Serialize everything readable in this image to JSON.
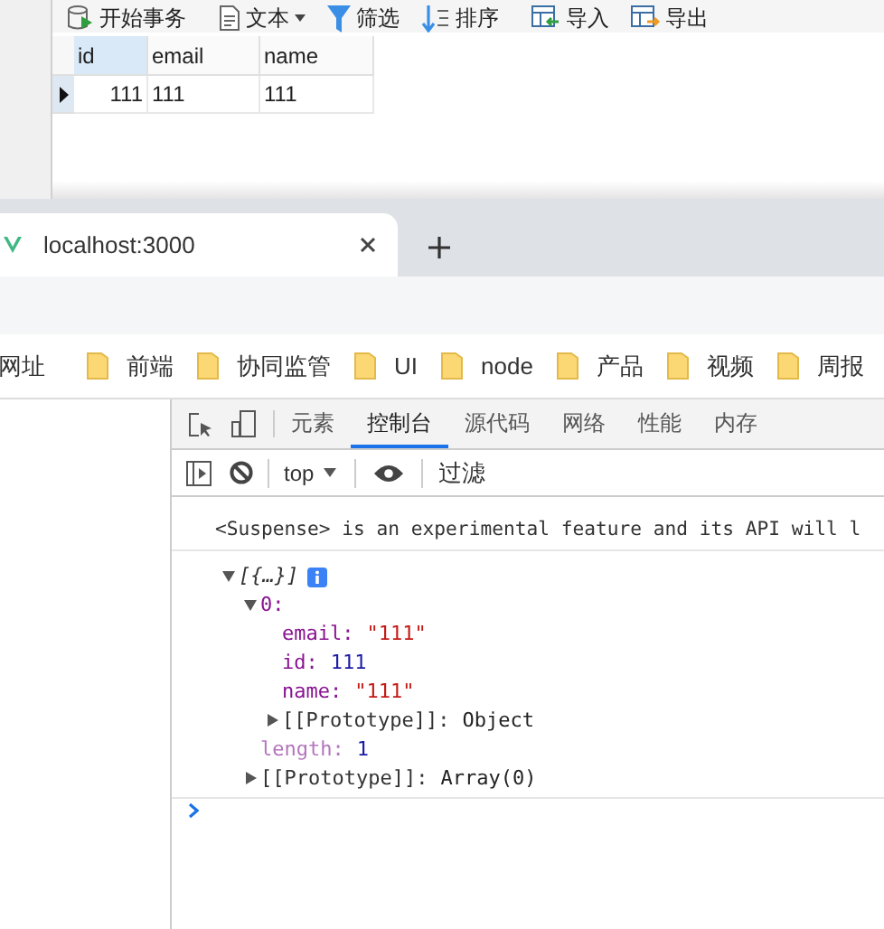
{
  "db_toolbar": [
    {
      "kind": "transaction",
      "label": "开始事务"
    },
    {
      "kind": "text",
      "label": "文本"
    },
    {
      "kind": "filter",
      "label": "筛选"
    },
    {
      "kind": "sort",
      "label": "排序"
    },
    {
      "kind": "import",
      "label": "导入"
    },
    {
      "kind": "export",
      "label": "导出"
    }
  ],
  "table": {
    "columns": [
      {
        "label": "id",
        "selected": true
      },
      {
        "label": "email",
        "selected": false
      },
      {
        "label": "name",
        "selected": false
      }
    ],
    "rows": [
      {
        "current": true,
        "cells": [
          "111",
          "111",
          "111"
        ]
      }
    ]
  },
  "browser": {
    "tab_title": "localhost:3000",
    "bookmarks": [
      {
        "kind": "text",
        "label": "网址"
      },
      {
        "kind": "folder",
        "label": "前端"
      },
      {
        "kind": "folder",
        "label": "协同监管"
      },
      {
        "kind": "folder",
        "label": "UI"
      },
      {
        "kind": "folder",
        "label": "node"
      },
      {
        "kind": "folder",
        "label": "产品"
      },
      {
        "kind": "folder",
        "label": "视频"
      },
      {
        "kind": "folder",
        "label": "周报"
      }
    ]
  },
  "devtools": {
    "tabs": [
      {
        "label": "元素",
        "selected": false
      },
      {
        "label": "控制台",
        "selected": true
      },
      {
        "label": "源代码",
        "selected": false
      },
      {
        "label": "网络",
        "selected": false
      },
      {
        "label": "性能",
        "selected": false
      },
      {
        "label": "内存",
        "selected": false
      }
    ],
    "context": "top",
    "filter_placeholder": "过滤",
    "message": "<Suspense> is an experimental feature and its API will l",
    "tree": [
      {
        "kind": "summary",
        "label": "[{…}]",
        "expanded": true,
        "children": [
          {
            "kind": "property",
            "key": "0:",
            "enumerable": true,
            "expanded": true,
            "children": [
              {
                "kind": "property",
                "key": "email:",
                "enumerable": true,
                "value": "\"111\"",
                "color": "#c41a16"
              },
              {
                "kind": "property",
                "key": "id:",
                "enumerable": true,
                "value": "111",
                "color": "#1a1aa6"
              },
              {
                "kind": "property",
                "key": "name:",
                "enumerable": true,
                "value": "\"111\"",
                "color": "#c41a16"
              },
              {
                "kind": "internal",
                "key": "[[Prototype]]:",
                "value": "Object",
                "color": "#222222",
                "expanded": false
              }
            ]
          },
          {
            "kind": "property",
            "key": "length:",
            "enumerable": false,
            "value": "1",
            "color": "#1a1aa6"
          },
          {
            "kind": "internal",
            "key": "[[Prototype]]:",
            "value": "Array(0)",
            "color": "#222222",
            "expanded": false
          }
        ]
      }
    ]
  }
}
